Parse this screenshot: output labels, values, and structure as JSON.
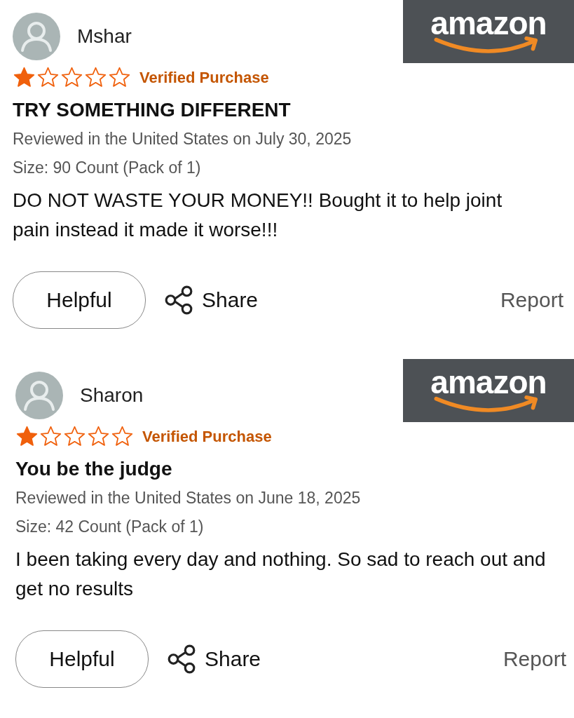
{
  "reviews": [
    {
      "reviewer": "Mshar",
      "logo": "amazon",
      "stars": 1,
      "badge": "Verified Purchase",
      "title": "TRY SOMETHING DIFFERENT",
      "meta": "Reviewed in the United States on July 30, 2025",
      "size": "Size: 90 Count (Pack of 1)",
      "body": "DO NOT WASTE YOUR MONEY!! Bought it to help joint pain instead it made it worse!!!",
      "helpful": "Helpful",
      "share": "Share",
      "report": "Report"
    },
    {
      "reviewer": "Sharon",
      "logo": "amazon",
      "stars": 1,
      "badge": "Verified Purchase",
      "title": "You be the judge",
      "meta": "Reviewed in the United States on June 18, 2025",
      "size": "Size: 42 Count (Pack of 1)",
      "body": "I been taking every day and nothing. So sad to reach out and get no results",
      "helpful": "Helpful",
      "share": "Share",
      "report": "Report"
    }
  ]
}
